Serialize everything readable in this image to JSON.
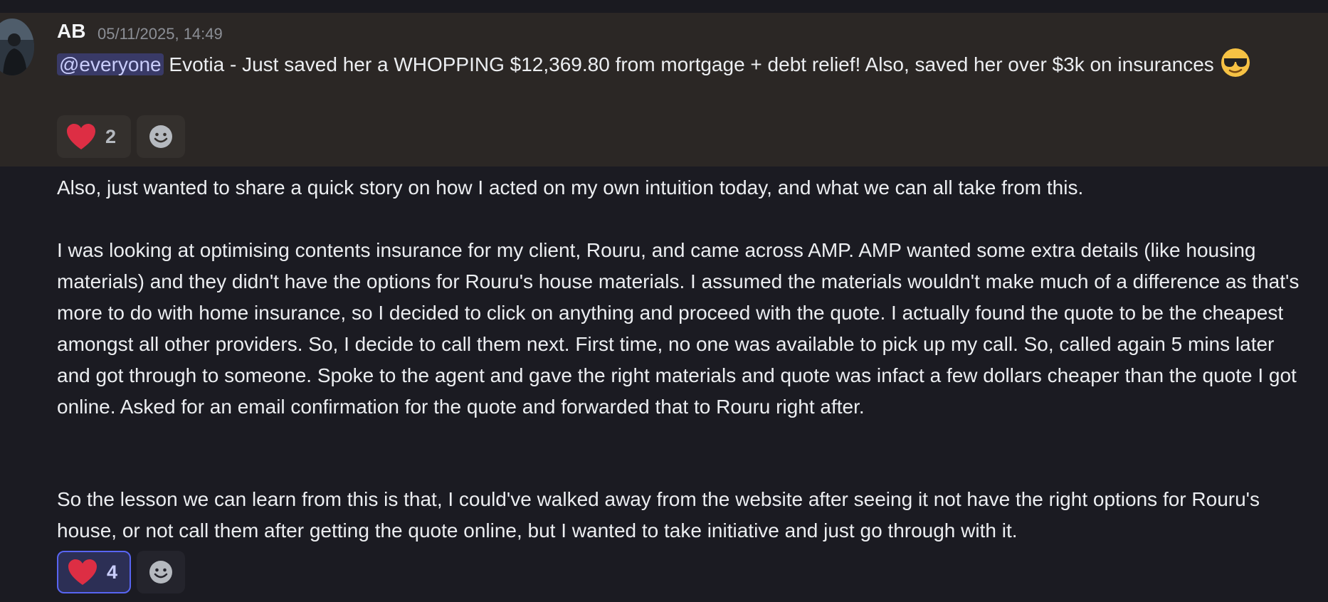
{
  "message1": {
    "author": "AB",
    "timestamp": "05/11/2025, 14:49",
    "mention": "@everyone",
    "text_after_mention": " Evotia - Just saved her a WHOPPING $12,369.80 from mortgage + debt relief! Also, saved her over $3k on insurances ",
    "emoji": "sunglasses-emoji",
    "reaction": {
      "emoji": "heart-icon",
      "count": "2"
    }
  },
  "message2": {
    "paragraph1": "Also, just wanted to share a quick story on how I acted on my own intuition today, and what we can all take from this.",
    "paragraph2": "I was looking at optimising contents insurance for my client, Rouru, and came across AMP. AMP wanted some extra details (like housing materials) and they didn't have the options for Rouru's house materials. I assumed the materials wouldn't make much of a difference as that's more to do with home insurance, so I decided to click on anything and proceed with the quote. I actually found the quote to be the cheapest amongst all other providers. So, I decide to call them next. First time, no one was available to pick up my call. So, called again 5 mins later and got through to someone. Spoke to the agent and gave the right materials and quote was infact a few dollars cheaper than the quote I got online. Asked for an email confirmation for the quote and forwarded that to Rouru right after.",
    "paragraph3": "So the lesson we can learn from this is that, I could've walked away from the website after seeing it not have the right options for Rouru's house, or not call them after getting the quote online, but I wanted to take initiative and just go through with it.",
    "reaction": {
      "emoji": "heart-icon",
      "count": "4"
    }
  },
  "colors": {
    "mention_bg": "#3b3f73",
    "mention_text": "#c9cdfb",
    "highlight_bg": "#2b2725",
    "reacted_border": "#5865f2"
  }
}
